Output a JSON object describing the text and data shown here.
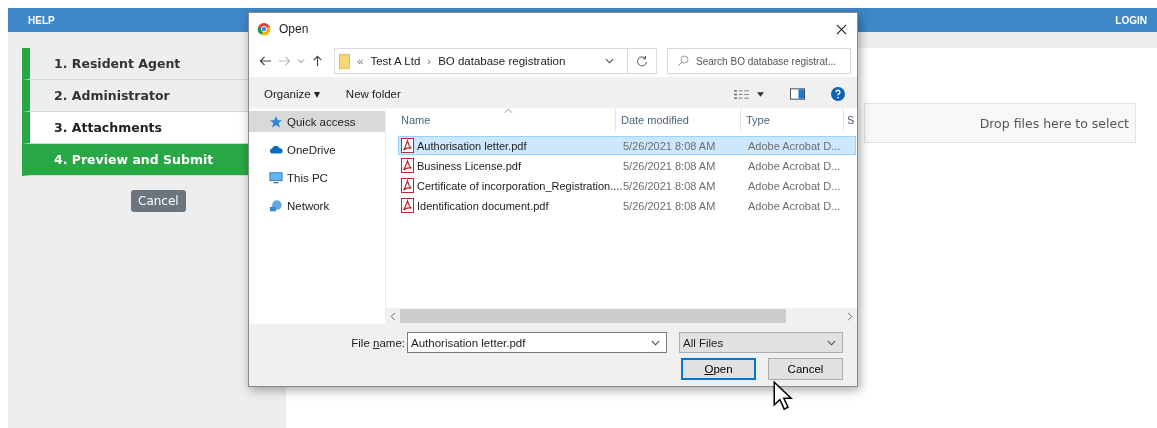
{
  "topbar": {
    "left_link": "HELP",
    "right_link": "LOGIN"
  },
  "steps": [
    {
      "label": "1. Resident Agent",
      "selected": false,
      "kind": "step"
    },
    {
      "label": "2. Administrator",
      "selected": false,
      "kind": "step"
    },
    {
      "label": "3. Attachments",
      "selected": true,
      "kind": "step"
    },
    {
      "label": "4. Preview and Submit",
      "selected": false,
      "kind": "submit"
    }
  ],
  "cancel_button": "Cancel",
  "dropzone": {
    "text": "Drop files here to select"
  },
  "dialog": {
    "title": "Open",
    "breadcrumb": [
      "«",
      "Test A Ltd",
      "›",
      "BO database registration"
    ],
    "search": {
      "placeholder": "Search BO database registrat..."
    },
    "toolbar": [
      "Organize ▾",
      "New folder"
    ],
    "nav": [
      {
        "label": "Quick access",
        "selected": true
      },
      {
        "label": "OneDrive",
        "selected": false
      },
      {
        "label": "This PC",
        "selected": false
      },
      {
        "label": "Network",
        "selected": false
      }
    ],
    "columns": [
      "Name",
      "Date modified",
      "Type",
      "S"
    ],
    "files": [
      {
        "name": "Authorisation letter.pdf",
        "date": "5/26/2021 8:08 AM",
        "type": "Adobe Acrobat D...",
        "selected": true
      },
      {
        "name": "Business License.pdf",
        "date": "5/26/2021 8:08 AM",
        "type": "Adobe Acrobat D...",
        "selected": false
      },
      {
        "name": "Certificate of incorporation_Registration....",
        "date": "5/26/2021 8:08 AM",
        "type": "Adobe Acrobat D...",
        "selected": false
      },
      {
        "name": "Identification document.pdf",
        "date": "5/26/2021 8:08 AM",
        "type": "Adobe Acrobat D...",
        "selected": false
      }
    ],
    "file_name_label": "File **n**ame:",
    "file_name_value": "Authorisation letter.pdf",
    "file_type": "All Files",
    "open_button": "**O**pen",
    "cancel_button": "Cancel"
  }
}
